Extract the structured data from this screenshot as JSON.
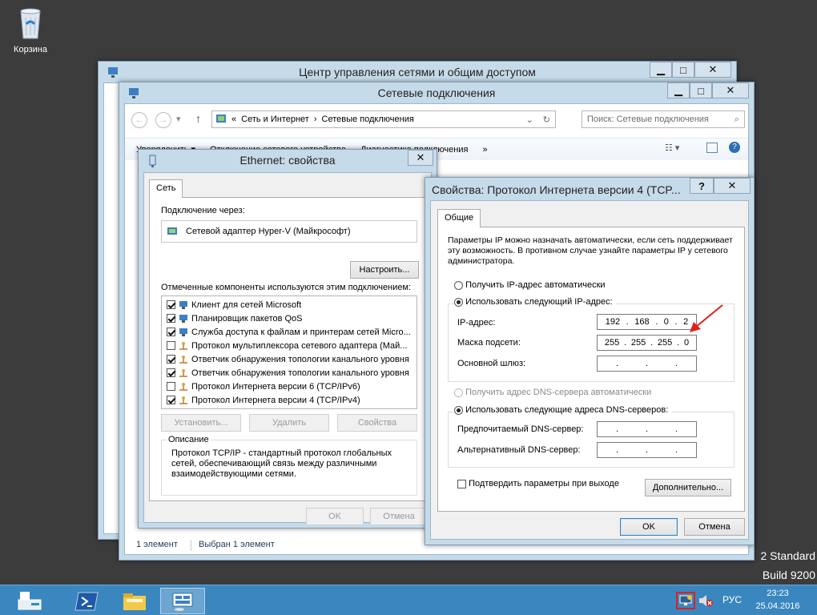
{
  "desktop": {
    "recycle_bin_label": "Корзина",
    "watermark_line1": "2 Standard",
    "watermark_line2": "Build 9200"
  },
  "network_center": {
    "title": "Центр управления сетями и общим доступом"
  },
  "network_connections": {
    "title": "Сетевые подключения",
    "breadcrumb_root": "«",
    "breadcrumb_1": "Сеть и Интернет",
    "breadcrumb_2": "Сетевые подключения",
    "search_placeholder": "Поиск: Сетевые подключения",
    "toolbar": {
      "organize": "Упорядочить",
      "disable_device": "Отключение сетевого устройства",
      "diagnose": "Диагностика подключения",
      "more": "»"
    },
    "status_count": "1 элемент",
    "status_selected": "Выбран 1 элемент"
  },
  "ethernet_props": {
    "title": "Ethernet: свойства",
    "tab": "Сеть",
    "connect_using_label": "Подключение через:",
    "adapter_name": "Сетевой адаптер Hyper-V (Майкрософт)",
    "configure_button": "Настроить...",
    "components_label": "Отмеченные компоненты используются этим подключением:",
    "components": [
      {
        "label": "Клиент для сетей Microsoft",
        "checked": true,
        "icon": "network-client-icon"
      },
      {
        "label": "Планировщик пакетов QoS",
        "checked": true,
        "icon": "qos-scheduler-icon"
      },
      {
        "label": "Служба доступа к файлам и принтерам сетей Micro...",
        "checked": true,
        "icon": "file-sharing-icon"
      },
      {
        "label": "Протокол мультиплексора сетевого адаптера (Май...",
        "checked": false,
        "icon": "protocol-icon"
      },
      {
        "label": "Ответчик обнаружения топологии канального уровня",
        "checked": true,
        "icon": "protocol-icon"
      },
      {
        "label": "Ответчик обнаружения топологии канального уровня",
        "checked": true,
        "icon": "protocol-icon"
      },
      {
        "label": "Протокол Интернета версии 6 (TCP/IPv6)",
        "checked": false,
        "icon": "protocol-icon"
      },
      {
        "label": "Протокол Интернета версии 4 (TCP/IPv4)",
        "checked": true,
        "icon": "protocol-icon"
      }
    ],
    "install_button": "Установить...",
    "remove_button": "Удалить",
    "properties_button": "Свойства",
    "description_heading": "Описание",
    "description_text": "Протокол TCP/IP - стандартный протокол глобальных сетей, обеспечивающий связь между различными взаимодействующими сетями.",
    "ok_button": "OK",
    "cancel_button": "Отмена"
  },
  "ipv4_props": {
    "title": "Свойства: Протокол Интернета версии 4 (TCP...",
    "help_glyph": "?",
    "tab": "Общие",
    "intro_text": "Параметры IP можно назначать автоматически, если сеть поддерживает эту возможность. В противном случае узнайте параметры IP у сетевого администратора.",
    "auto_ip_label": "Получить IP-адрес автоматически",
    "manual_ip_label": "Использовать следующий IP-адрес:",
    "ip_label": "IP-адрес:",
    "ip_octets": [
      "192",
      "168",
      "0",
      "2"
    ],
    "mask_label": "Маска подсети:",
    "mask_octets": [
      "255",
      "255",
      "255",
      "0"
    ],
    "gateway_label": "Основной шлюз:",
    "auto_dns_label": "Получить адрес DNS-сервера автоматически",
    "manual_dns_label": "Использовать следующие адреса DNS-серверов:",
    "preferred_dns_label": "Предпочитаемый DNS-сервер:",
    "alternate_dns_label": "Альтернативный DNS-сервер:",
    "validate_label": "Подтвердить параметры при выходе",
    "advanced_button": "Дополнительно...",
    "ok_button": "OK",
    "cancel_button": "Отмена",
    "arrow_color": "#e0201c"
  },
  "taskbar": {
    "language": "РУС",
    "time": "23:23",
    "date": "25.04.2016",
    "color": "#3a87c0"
  }
}
